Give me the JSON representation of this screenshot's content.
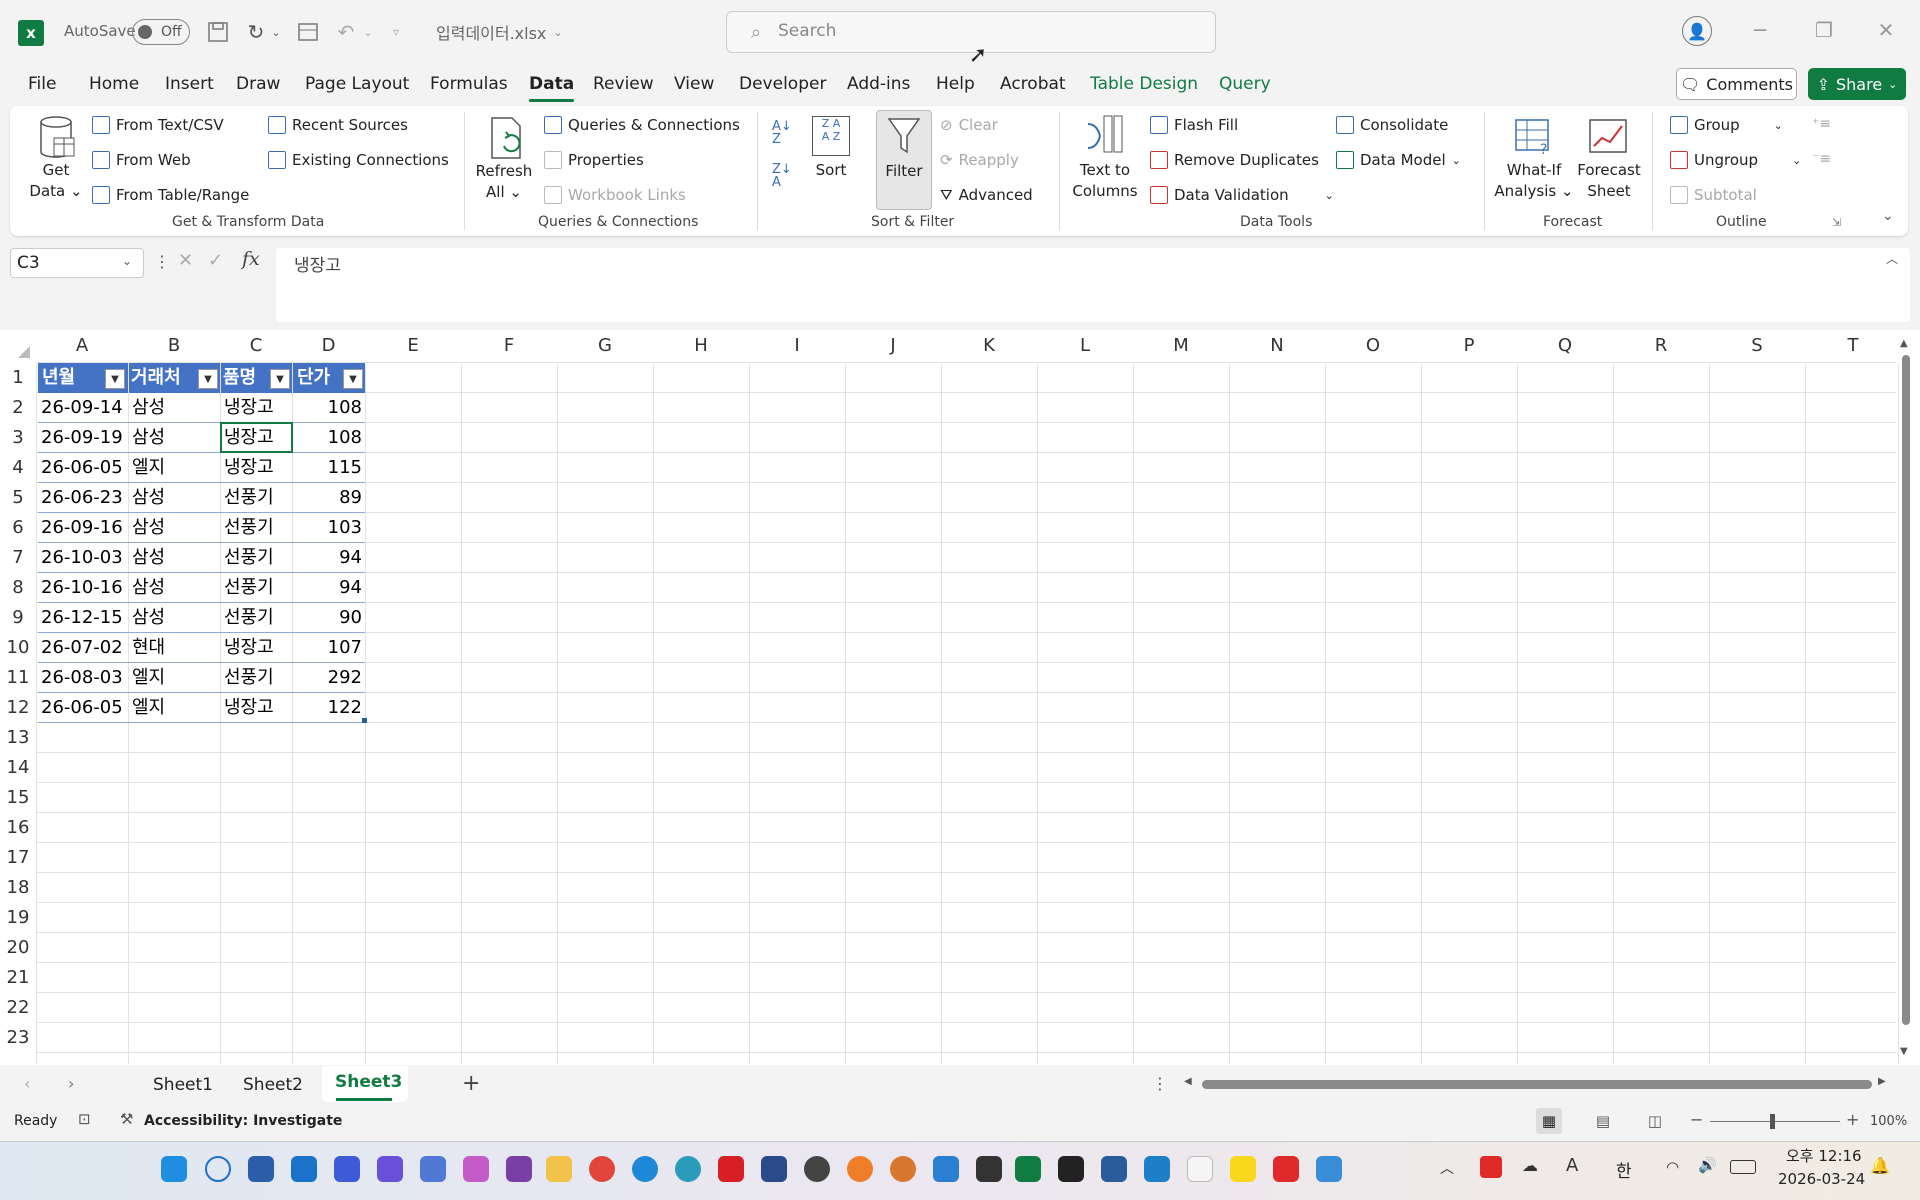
{
  "titlebar": {
    "autosave_label": "AutoSave",
    "autosave_state": "Off",
    "filename": "입력데이터.xlsx",
    "search_placeholder": "Search"
  },
  "menus": [
    "File",
    "Home",
    "Insert",
    "Draw",
    "Page Layout",
    "Formulas",
    "Data",
    "Review",
    "View",
    "Developer",
    "Add-ins",
    "Help",
    "Acrobat",
    "Table Design",
    "Query"
  ],
  "active_menu": "Data",
  "buttons": {
    "comments": "Comments",
    "share": "Share"
  },
  "ribbon": {
    "get_data": "Get Data",
    "from_text_csv": "From Text/CSV",
    "from_web": "From Web",
    "from_table_range": "From Table/Range",
    "recent_sources": "Recent Sources",
    "existing_connections": "Existing Connections",
    "group_get_transform": "Get & Transform Data",
    "refresh_all": "Refresh All",
    "queries_connections": "Queries & Connections",
    "properties": "Properties",
    "workbook_links": "Workbook Links",
    "group_queries": "Queries & Connections",
    "sort": "Sort",
    "filter": "Filter",
    "clear": "Clear",
    "reapply": "Reapply",
    "advanced": "Advanced",
    "group_sort_filter": "Sort & Filter",
    "text_to_columns": "Text to Columns",
    "flash_fill": "Flash Fill",
    "remove_duplicates": "Remove Duplicates",
    "data_validation": "Data Validation",
    "consolidate": "Consolidate",
    "data_model": "Data Model",
    "group_data_tools": "Data Tools",
    "what_if": "What-If Analysis",
    "forecast_sheet": "Forecast Sheet",
    "group_forecast": "Forecast",
    "group": "Group",
    "ungroup": "Ungroup",
    "subtotal": "Subtotal",
    "group_outline": "Outline"
  },
  "formula_bar": {
    "name_box": "C3",
    "content": "냉장고"
  },
  "columns": [
    "A",
    "B",
    "C",
    "D",
    "E",
    "F",
    "G",
    "H",
    "I",
    "J",
    "K",
    "L",
    "M",
    "N",
    "O",
    "P",
    "Q",
    "R",
    "S",
    "T"
  ],
  "row_numbers": [
    "1",
    "2",
    "3",
    "4",
    "5",
    "6",
    "7",
    "8",
    "9",
    "10",
    "11",
    "12",
    "13",
    "14",
    "15",
    "16",
    "17",
    "18",
    "19",
    "20",
    "21",
    "22",
    "23"
  ],
  "table": {
    "headers": [
      "년월",
      "거래처",
      "품명",
      "단가"
    ],
    "rows": [
      [
        "26-09-14",
        "삼성",
        "냉장고",
        "108"
      ],
      [
        "26-09-19",
        "삼성",
        "냉장고",
        "108"
      ],
      [
        "26-06-05",
        "엘지",
        "냉장고",
        "115"
      ],
      [
        "26-06-23",
        "삼성",
        "선풍기",
        "89"
      ],
      [
        "26-09-16",
        "삼성",
        "선풍기",
        "103"
      ],
      [
        "26-10-03",
        "삼성",
        "선풍기",
        "94"
      ],
      [
        "26-10-16",
        "삼성",
        "선풍기",
        "94"
      ],
      [
        "26-12-15",
        "삼성",
        "선풍기",
        "90"
      ],
      [
        "26-07-02",
        "현대",
        "냉장고",
        "107"
      ],
      [
        "26-08-03",
        "엘지",
        "선풍기",
        "292"
      ],
      [
        "26-06-05",
        "엘지",
        "냉장고",
        "122"
      ]
    ]
  },
  "sheets": [
    "Sheet1",
    "Sheet2",
    "Sheet3"
  ],
  "active_sheet": "Sheet3",
  "status": {
    "ready": "Ready",
    "accessibility": "Accessibility: Investigate",
    "zoom": "100%"
  },
  "clock": {
    "time": "오후 12:16",
    "date": "2026-03-24"
  },
  "tray": {
    "ime": "한"
  }
}
